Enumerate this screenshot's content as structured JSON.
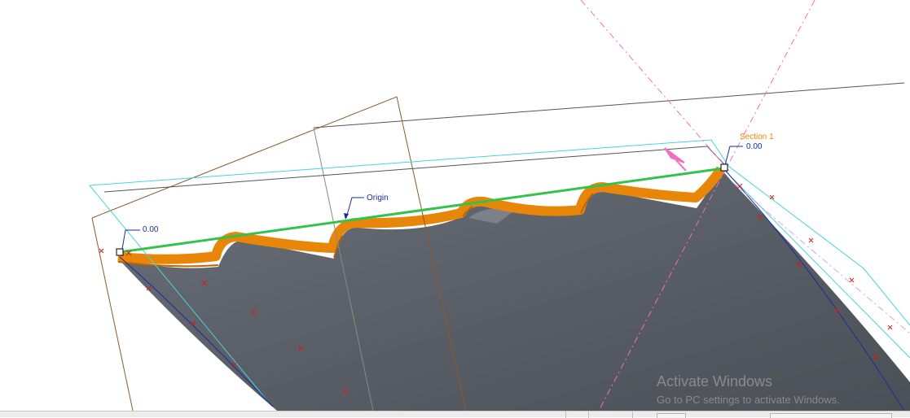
{
  "labels": {
    "origin": "Origin",
    "section": "Section 1",
    "dim_left": "0.00",
    "dim_right": "0.00"
  },
  "watermark": {
    "title": "Activate Windows",
    "subtitle": "Go to PC settings to activate Windows."
  },
  "colors": {
    "surface": "#5a5e66",
    "trim_edge": "#e8860a",
    "section_line": "#33c24a",
    "datum_plane": "#8b5a2b",
    "sketch_plane": "#45d5d8",
    "centerline": "#f06fc0",
    "dimension": "#1a2d9c",
    "section_label": "#e08a00",
    "point_marker": "#cc2222"
  }
}
